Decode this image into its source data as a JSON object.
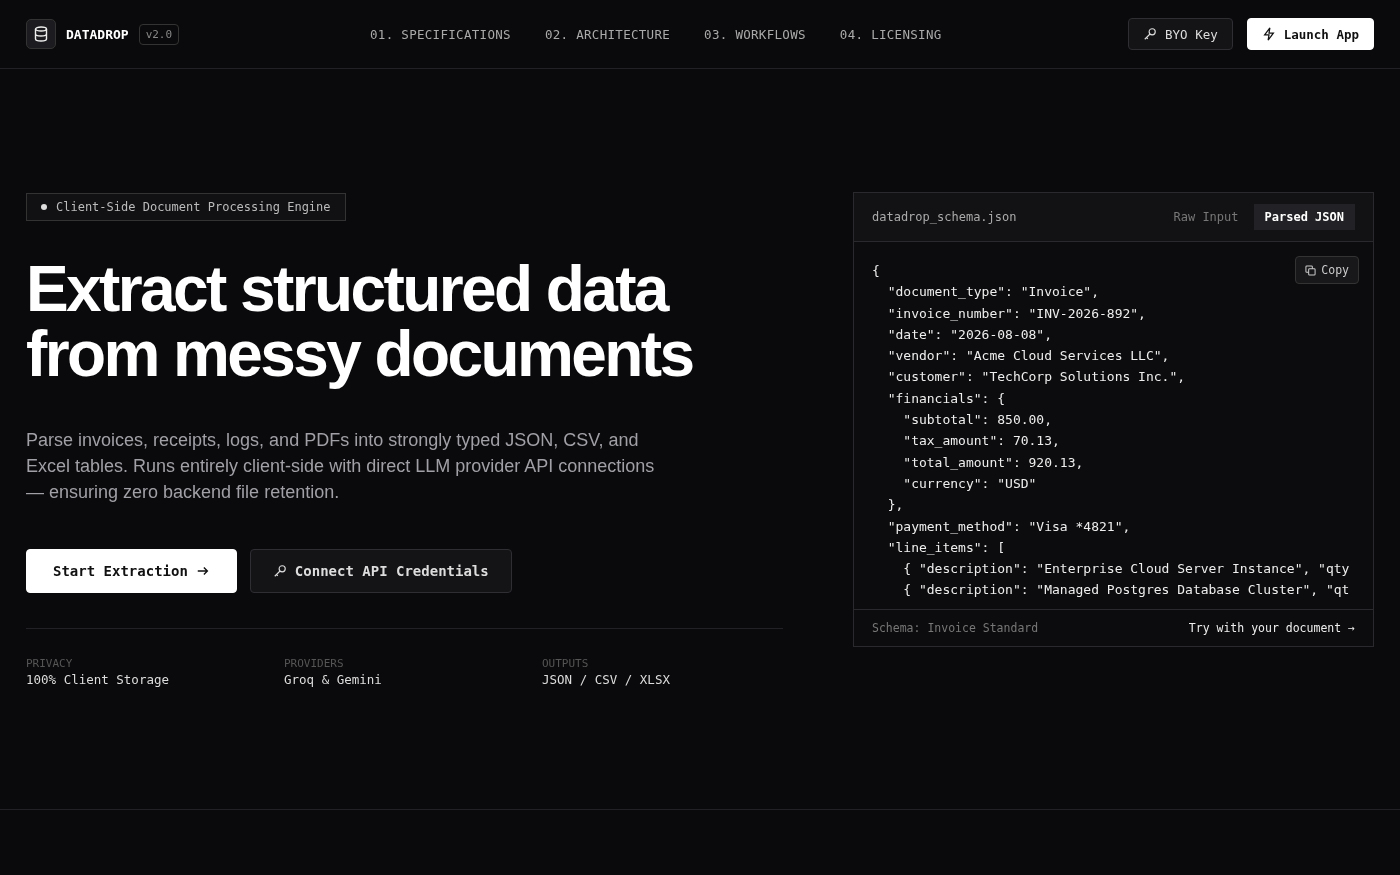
{
  "brand": {
    "name": "DATADROP",
    "version": "v2.0"
  },
  "nav": [
    {
      "label": "01. SPECIFICATIONS"
    },
    {
      "label": "02. ARCHITECTURE"
    },
    {
      "label": "03. WORKFLOWS"
    },
    {
      "label": "04. LICENSING"
    }
  ],
  "header_buttons": [
    {
      "label": "BYO Key",
      "kind": "secondary"
    },
    {
      "label": "Launch App",
      "kind": "primary"
    }
  ],
  "badge": "Client-Side Document Processing Engine",
  "headline": [
    "Extract structured data",
    "from messy documents"
  ],
  "description": "Parse invoices, receipts, logs, and PDFs into strongly typed JSON, CSV, and Excel tables. Runs entirely client-side with direct LLM provider API connections — ensuring zero backend file retention.",
  "actions": [
    {
      "label": "Start Extraction",
      "kind": "primary"
    },
    {
      "label": "Connect API Credentials",
      "kind": "secondary"
    }
  ],
  "stats": [
    {
      "label": "PRIVACY",
      "value": "100% Client Storage"
    },
    {
      "label": "PROVIDERS",
      "value": "Groq & Gemini"
    },
    {
      "label": "OUTPUTS",
      "value": "JSON / CSV / XLSX"
    }
  ],
  "panel": {
    "filename": "datadrop_schema.json",
    "tabs": [
      {
        "label": "Raw Input",
        "selected": false
      },
      {
        "label": "Parsed JSON",
        "selected": true
      }
    ],
    "copy": "Copy",
    "code": [
      "{",
      "  \"document_type\": \"Invoice\",",
      "  \"invoice_number\": \"INV-2026-892\",",
      "  \"date\": \"2026-08-08\",",
      "  \"vendor\": \"Acme Cloud Services LLC\",",
      "  \"customer\": \"TechCorp Solutions Inc.\",",
      "  \"financials\": {",
      "    \"subtotal\": 850.00,",
      "    \"tax_amount\": 70.13,",
      "    \"total_amount\": 920.13,",
      "    \"currency\": \"USD\"",
      "  },",
      "  \"payment_method\": \"Visa *4821\",",
      "  \"line_items\": [",
      "    { \"description\": \"Enterprise Cloud Server Instance\", \"qty",
      "    { \"description\": \"Managed Postgres Database Cluster\", \"qt"
    ],
    "footer_left": "Schema: Invoice Standard",
    "footer_right": "Try with your document →"
  }
}
